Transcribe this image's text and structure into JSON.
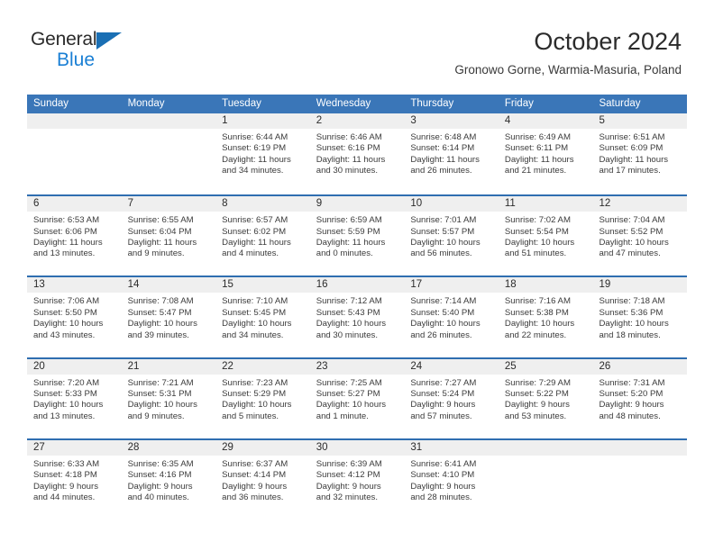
{
  "brand": {
    "name_top": "General",
    "name_bottom": "Blue",
    "triangle_icon": "triangle-logo-icon",
    "color_top": "#2b2b2b",
    "color_bottom": "#1a7fd4",
    "triangle_color": "#1a6fb4"
  },
  "header": {
    "month_title": "October 2024",
    "location": "Gronowo Gorne, Warmia-Masuria, Poland"
  },
  "colors": {
    "header_blue": "#3a76b8",
    "row_divider_blue": "#2f6eb0",
    "daynum_band_gray": "#efefef",
    "text_dark": "#2b2b2b",
    "text_body": "#3b3b3b"
  },
  "calendar": {
    "day_names": [
      "Sunday",
      "Monday",
      "Tuesday",
      "Wednesday",
      "Thursday",
      "Friday",
      "Saturday"
    ],
    "weeks": [
      [
        {
          "day": "",
          "lines": []
        },
        {
          "day": "",
          "lines": []
        },
        {
          "day": "1",
          "lines": [
            "Sunrise: 6:44 AM",
            "Sunset: 6:19 PM",
            "Daylight: 11 hours",
            "and 34 minutes."
          ]
        },
        {
          "day": "2",
          "lines": [
            "Sunrise: 6:46 AM",
            "Sunset: 6:16 PM",
            "Daylight: 11 hours",
            "and 30 minutes."
          ]
        },
        {
          "day": "3",
          "lines": [
            "Sunrise: 6:48 AM",
            "Sunset: 6:14 PM",
            "Daylight: 11 hours",
            "and 26 minutes."
          ]
        },
        {
          "day": "4",
          "lines": [
            "Sunrise: 6:49 AM",
            "Sunset: 6:11 PM",
            "Daylight: 11 hours",
            "and 21 minutes."
          ]
        },
        {
          "day": "5",
          "lines": [
            "Sunrise: 6:51 AM",
            "Sunset: 6:09 PM",
            "Daylight: 11 hours",
            "and 17 minutes."
          ]
        }
      ],
      [
        {
          "day": "6",
          "lines": [
            "Sunrise: 6:53 AM",
            "Sunset: 6:06 PM",
            "Daylight: 11 hours",
            "and 13 minutes."
          ]
        },
        {
          "day": "7",
          "lines": [
            "Sunrise: 6:55 AM",
            "Sunset: 6:04 PM",
            "Daylight: 11 hours",
            "and 9 minutes."
          ]
        },
        {
          "day": "8",
          "lines": [
            "Sunrise: 6:57 AM",
            "Sunset: 6:02 PM",
            "Daylight: 11 hours",
            "and 4 minutes."
          ]
        },
        {
          "day": "9",
          "lines": [
            "Sunrise: 6:59 AM",
            "Sunset: 5:59 PM",
            "Daylight: 11 hours",
            "and 0 minutes."
          ]
        },
        {
          "day": "10",
          "lines": [
            "Sunrise: 7:01 AM",
            "Sunset: 5:57 PM",
            "Daylight: 10 hours",
            "and 56 minutes."
          ]
        },
        {
          "day": "11",
          "lines": [
            "Sunrise: 7:02 AM",
            "Sunset: 5:54 PM",
            "Daylight: 10 hours",
            "and 51 minutes."
          ]
        },
        {
          "day": "12",
          "lines": [
            "Sunrise: 7:04 AM",
            "Sunset: 5:52 PM",
            "Daylight: 10 hours",
            "and 47 minutes."
          ]
        }
      ],
      [
        {
          "day": "13",
          "lines": [
            "Sunrise: 7:06 AM",
            "Sunset: 5:50 PM",
            "Daylight: 10 hours",
            "and 43 minutes."
          ]
        },
        {
          "day": "14",
          "lines": [
            "Sunrise: 7:08 AM",
            "Sunset: 5:47 PM",
            "Daylight: 10 hours",
            "and 39 minutes."
          ]
        },
        {
          "day": "15",
          "lines": [
            "Sunrise: 7:10 AM",
            "Sunset: 5:45 PM",
            "Daylight: 10 hours",
            "and 34 minutes."
          ]
        },
        {
          "day": "16",
          "lines": [
            "Sunrise: 7:12 AM",
            "Sunset: 5:43 PM",
            "Daylight: 10 hours",
            "and 30 minutes."
          ]
        },
        {
          "day": "17",
          "lines": [
            "Sunrise: 7:14 AM",
            "Sunset: 5:40 PM",
            "Daylight: 10 hours",
            "and 26 minutes."
          ]
        },
        {
          "day": "18",
          "lines": [
            "Sunrise: 7:16 AM",
            "Sunset: 5:38 PM",
            "Daylight: 10 hours",
            "and 22 minutes."
          ]
        },
        {
          "day": "19",
          "lines": [
            "Sunrise: 7:18 AM",
            "Sunset: 5:36 PM",
            "Daylight: 10 hours",
            "and 18 minutes."
          ]
        }
      ],
      [
        {
          "day": "20",
          "lines": [
            "Sunrise: 7:20 AM",
            "Sunset: 5:33 PM",
            "Daylight: 10 hours",
            "and 13 minutes."
          ]
        },
        {
          "day": "21",
          "lines": [
            "Sunrise: 7:21 AM",
            "Sunset: 5:31 PM",
            "Daylight: 10 hours",
            "and 9 minutes."
          ]
        },
        {
          "day": "22",
          "lines": [
            "Sunrise: 7:23 AM",
            "Sunset: 5:29 PM",
            "Daylight: 10 hours",
            "and 5 minutes."
          ]
        },
        {
          "day": "23",
          "lines": [
            "Sunrise: 7:25 AM",
            "Sunset: 5:27 PM",
            "Daylight: 10 hours",
            "and 1 minute."
          ]
        },
        {
          "day": "24",
          "lines": [
            "Sunrise: 7:27 AM",
            "Sunset: 5:24 PM",
            "Daylight: 9 hours",
            "and 57 minutes."
          ]
        },
        {
          "day": "25",
          "lines": [
            "Sunrise: 7:29 AM",
            "Sunset: 5:22 PM",
            "Daylight: 9 hours",
            "and 53 minutes."
          ]
        },
        {
          "day": "26",
          "lines": [
            "Sunrise: 7:31 AM",
            "Sunset: 5:20 PM",
            "Daylight: 9 hours",
            "and 48 minutes."
          ]
        }
      ],
      [
        {
          "day": "27",
          "lines": [
            "Sunrise: 6:33 AM",
            "Sunset: 4:18 PM",
            "Daylight: 9 hours",
            "and 44 minutes."
          ]
        },
        {
          "day": "28",
          "lines": [
            "Sunrise: 6:35 AM",
            "Sunset: 4:16 PM",
            "Daylight: 9 hours",
            "and 40 minutes."
          ]
        },
        {
          "day": "29",
          "lines": [
            "Sunrise: 6:37 AM",
            "Sunset: 4:14 PM",
            "Daylight: 9 hours",
            "and 36 minutes."
          ]
        },
        {
          "day": "30",
          "lines": [
            "Sunrise: 6:39 AM",
            "Sunset: 4:12 PM",
            "Daylight: 9 hours",
            "and 32 minutes."
          ]
        },
        {
          "day": "31",
          "lines": [
            "Sunrise: 6:41 AM",
            "Sunset: 4:10 PM",
            "Daylight: 9 hours",
            "and 28 minutes."
          ]
        },
        {
          "day": "",
          "lines": []
        },
        {
          "day": "",
          "lines": []
        }
      ]
    ]
  }
}
